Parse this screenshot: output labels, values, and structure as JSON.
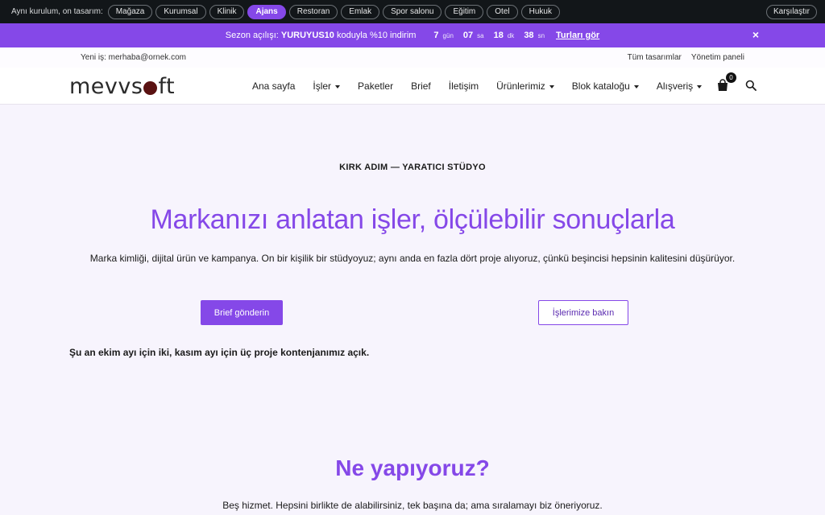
{
  "switcher": {
    "label": "Aynı kurulum, on tasarım:",
    "pills": [
      {
        "label": "Mağaza",
        "active": false
      },
      {
        "label": "Kurumsal",
        "active": false
      },
      {
        "label": "Klinik",
        "active": false
      },
      {
        "label": "Ajans",
        "active": true
      },
      {
        "label": "Restoran",
        "active": false
      },
      {
        "label": "Emlak",
        "active": false
      },
      {
        "label": "Spor salonu",
        "active": false
      },
      {
        "label": "Eğitim",
        "active": false
      },
      {
        "label": "Otel",
        "active": false
      },
      {
        "label": "Hukuk",
        "active": false
      }
    ],
    "compare_label": "Karşılaştır"
  },
  "promo": {
    "prefix": "Sezon açılışı:",
    "code": "YURUYUS10",
    "suffix": "koduyla %10 indirim",
    "countdown": [
      {
        "value": "7",
        "unit": "gün"
      },
      {
        "value": "07",
        "unit": "sa"
      },
      {
        "value": "18",
        "unit": "dk"
      },
      {
        "value": "38",
        "unit": "sn"
      }
    ],
    "link_label": "Turları gör",
    "close_label": "×"
  },
  "utility": {
    "job_text": "Yeni iş: merhaba@ornek.com",
    "links": [
      "Tüm tasarımlar",
      "Yönetim paneli"
    ]
  },
  "nav": {
    "logo_before": "mevvs",
    "logo_after": "ft",
    "items": [
      {
        "label": "Ana sayfa",
        "dropdown": false
      },
      {
        "label": "İşler",
        "dropdown": true
      },
      {
        "label": "Paketler",
        "dropdown": false
      },
      {
        "label": "Brief",
        "dropdown": false
      },
      {
        "label": "İletişim",
        "dropdown": false
      },
      {
        "label": "Ürünlerimiz",
        "dropdown": true
      },
      {
        "label": "Blok kataloğu",
        "dropdown": true
      },
      {
        "label": "Alışveriş",
        "dropdown": true
      }
    ],
    "cart_count": "0"
  },
  "hero": {
    "eyebrow": "KIRK ADIM — YARATICI STÜDYO",
    "title": "Markanızı anlatan işler, ölçülebilir sonuçlarla",
    "subtitle": "Marka kimliği, dijital ürün ve kampanya. On bir kişilik bir stüdyoyuz; aynı anda en fazla dört proje alıyoruz, çünkü beşincisi hepsinin kalitesini düşürüyor.",
    "primary_cta": "Brief gönderin",
    "secondary_cta": "İşlerimize bakın",
    "capacity": "Şu an ekim ayı için iki, kasım ayı için üç proje kontenjanımız açık."
  },
  "services": {
    "title": "Ne yapıyoruz?",
    "subtitle": "Beş hizmet. Hepsini birlikte de alabilirsiniz, tek başına da; ama sıralamayı biz öneriyoruz."
  },
  "colors": {
    "accent": "#8548e8",
    "topbar": "#121619"
  }
}
